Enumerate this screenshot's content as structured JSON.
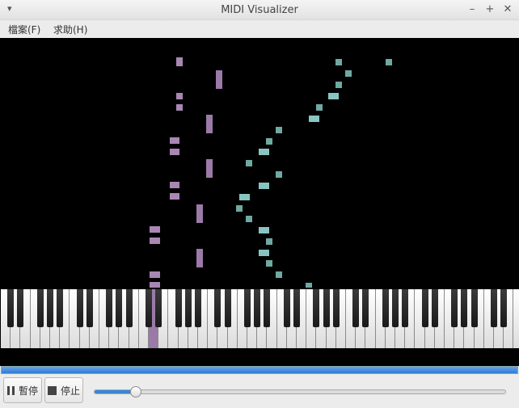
{
  "window": {
    "title": "MIDI Visualizer",
    "menu_glyph": "▾",
    "controls": [
      "–",
      "+",
      "✕"
    ]
  },
  "menubar": {
    "items": [
      "檔案(F)",
      "求助(H)"
    ]
  },
  "playback": {
    "pause_label": "暫停",
    "stop_label": "停止",
    "progress_fraction": 1.0,
    "volume_fraction": 0.1
  },
  "colors": {
    "purple_note": "#a887b3",
    "teal_note": "#88c5c0",
    "highlight_purple": "#9b7aa8",
    "highlight_teal": "#5f9d92",
    "progress": "#2d7bd6"
  },
  "keyboard": {
    "pressed_keys": [
      "purple",
      "teal"
    ]
  }
}
